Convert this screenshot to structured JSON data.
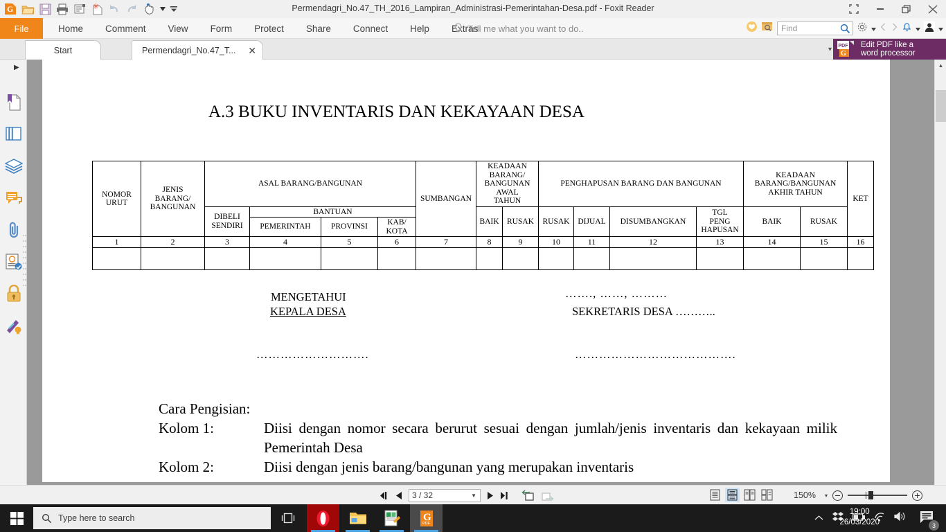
{
  "window": {
    "title": "Permendagri_No.47_TH_2016_Lampiran_Administrasi-Pemerintahan-Desa.pdf - Foxit Reader",
    "controls": {
      "restore_all": "⛶",
      "minimize": "—",
      "maximize": "❐",
      "close": "✕"
    }
  },
  "quick_access": [
    {
      "name": "foxit-logo-icon",
      "label": "G"
    },
    {
      "name": "open-folder-icon",
      "label": "Open"
    },
    {
      "name": "save-icon",
      "label": "Save"
    },
    {
      "name": "print-icon",
      "label": "Print"
    },
    {
      "name": "email-icon",
      "label": "Email"
    },
    {
      "name": "new-from-file-icon",
      "label": "Create PDF"
    },
    {
      "name": "undo-icon",
      "label": "Undo"
    },
    {
      "name": "redo-icon",
      "label": "Redo"
    },
    {
      "name": "hand-tool-icon",
      "label": "Hand Tool"
    },
    {
      "name": "customize-toolbar-icon",
      "label": "Customize"
    }
  ],
  "menu": {
    "file_label": "File",
    "items": [
      "Home",
      "Comment",
      "View",
      "Form",
      "Protect",
      "Share",
      "Connect",
      "Help",
      "Extras"
    ],
    "tell_me": "Tell me what you want to do..",
    "find_placeholder": "Find"
  },
  "tabs": {
    "start": "Start",
    "document": "Permendagri_No.47_T...",
    "close_glyph": "✕",
    "overflow_glyph": "▾"
  },
  "promo": {
    "line1": "Edit PDF like a",
    "line2": "word processor"
  },
  "rail": [
    {
      "name": "bookmarks-icon",
      "label": "Bookmarks"
    },
    {
      "name": "pages-thumbnails-icon",
      "label": "Page Thumbnails"
    },
    {
      "name": "layers-icon",
      "label": "Layers"
    },
    {
      "name": "comments-icon",
      "label": "Comments"
    },
    {
      "name": "attachments-icon",
      "label": "Attachments"
    },
    {
      "name": "stamps-icon",
      "label": "Stamps"
    },
    {
      "name": "security-lock-icon",
      "label": "Security"
    },
    {
      "name": "digital-signature-icon",
      "label": "Digital Signatures"
    }
  ],
  "document": {
    "heading": "A.3 BUKU INVENTARIS DAN KEKAYAAN DESA",
    "table": {
      "row1": [
        {
          "text": "NOMOR\nURUT",
          "rowspan": 3,
          "w": 70
        },
        {
          "text": "JENIS\nBARANG/\nBANGUNAN",
          "rowspan": 3,
          "w": 92
        },
        {
          "text": "ASAL BARANG/BANGUNAN",
          "colspan": 4
        },
        {
          "text": "SUMBANGAN",
          "rowspan": 3,
          "w": 87
        },
        {
          "text": "KEADAAN\nBARANG/\nBANGUNAN\nAWAL\nTAHUN",
          "colspan": 2
        },
        {
          "text": "PENGHAPUSAN BARANG DAN BANGUNAN",
          "colspan": 4
        },
        {
          "text": "KEADAAN\nBARANG/BANGUNAN\nAKHIR TAHUN",
          "colspan": 2
        },
        {
          "text": "KET",
          "rowspan": 3,
          "w": 38
        }
      ],
      "row2": [
        {
          "text": "DIBELI\nSENDIRI",
          "rowspan": 2,
          "w": 65
        },
        {
          "text": "BANTUAN",
          "colspan": 3
        }
      ],
      "row3_left": [
        {
          "text": "PEMERINTAH",
          "w": 103
        },
        {
          "text": "PROVINSI",
          "w": 82
        },
        {
          "text": "KAB/\nKOTA",
          "w": 55
        }
      ],
      "row3_right": [
        {
          "text": "BAIK",
          "w": 38
        },
        {
          "text": "RUSAK",
          "w": 52
        },
        {
          "text": "RUSAK",
          "w": 51
        },
        {
          "text": "DIJUAL",
          "w": 52
        },
        {
          "text": "DISUMBANGKAN",
          "w": 125
        },
        {
          "text": "TGL\nPENG\nHAPUSAN",
          "w": 68
        },
        {
          "text": "BAIK",
          "w": 82
        },
        {
          "text": "RUSAK",
          "w": 68
        }
      ],
      "numbers": [
        "1",
        "2",
        "3",
        "4",
        "5",
        "6",
        "7",
        "8",
        "9",
        "10",
        "11",
        "12",
        "13",
        "14",
        "15",
        "16"
      ]
    },
    "signatures": {
      "left_line1": "MENGETAHUI",
      "left_line2": "KEPALA DESA",
      "left_dots": "……………………….",
      "right_date": "……., ……, ………",
      "right_title": "SEKRETARIS DESA ………..",
      "right_dots": "…………………………………."
    },
    "instructions": {
      "title": "Cara Pengisian:",
      "rows": [
        {
          "label": "Kolom 1:",
          "text": "Diisi dengan nomor secara berurut sesuai dengan jumlah/jenis inventaris dan kekayaan milik Pemerintah Desa"
        },
        {
          "label": "Kolom 2:",
          "text": "Diisi dengan jenis barang/bangunan yang merupakan inventaris"
        }
      ]
    }
  },
  "statusbar": {
    "first_page": "◀|",
    "prev_page": "◀",
    "page_value": "3 / 32",
    "next_page": "▶",
    "last_page": "|▶",
    "view_modes": [
      {
        "name": "single-page-view-icon",
        "active": false
      },
      {
        "name": "continuous-view-icon",
        "active": true
      },
      {
        "name": "facing-view-icon",
        "active": false
      },
      {
        "name": "continuous-facing-view-icon",
        "active": false
      }
    ],
    "zoom_level": "150%",
    "zoom_caret": "▾"
  },
  "taskbar": {
    "search_placeholder": "Type here to search",
    "apps": [
      {
        "name": "task-view-icon",
        "label": "Task View"
      },
      {
        "name": "opera-browser-icon",
        "label": "Opera"
      },
      {
        "name": "file-explorer-icon",
        "label": "File Explorer"
      },
      {
        "name": "excel-icon",
        "label": "Excel"
      },
      {
        "name": "foxit-reader-icon",
        "label": "Foxit Reader"
      }
    ],
    "tray": [
      {
        "name": "show-hidden-icons-icon",
        "glyph": "⌃"
      },
      {
        "name": "dropbox-icon",
        "glyph": "▼"
      },
      {
        "name": "battery-icon",
        "glyph": "▭"
      },
      {
        "name": "wifi-icon",
        "glyph": "◜"
      },
      {
        "name": "volume-icon",
        "glyph": "🔊"
      }
    ],
    "time": "19:00",
    "date": "26/03/2020",
    "notification_count": "3"
  }
}
